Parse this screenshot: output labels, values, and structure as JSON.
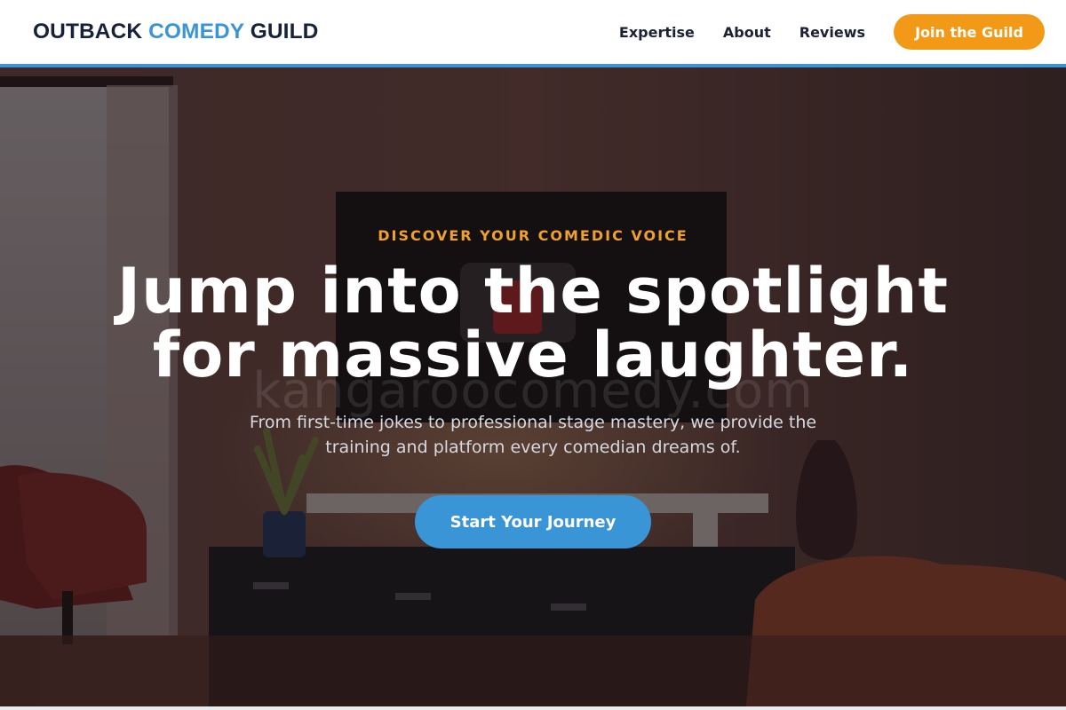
{
  "brand": {
    "logo_part1": "OUTBACK ",
    "logo_part2": "COMEDY",
    "logo_part3": " GUILD",
    "accent_color": "#3a95d6",
    "cta_color": "#f29a17"
  },
  "nav": {
    "links": [
      "Expertise",
      "About",
      "Reviews"
    ],
    "join_label": "Join the Guild"
  },
  "hero": {
    "eyebrow": "DISCOVER YOUR COMEDIC VOICE",
    "headline_line1": "Jump into the spotlight",
    "headline_line2": "for massive laughter.",
    "sub_line1": "From first-time jokes to professional stage mastery, we provide the",
    "sub_line2": "training and platform every comedian dreams of.",
    "cta_label": "Start Your Journey",
    "watermark": "kangaroocomedy.com"
  }
}
